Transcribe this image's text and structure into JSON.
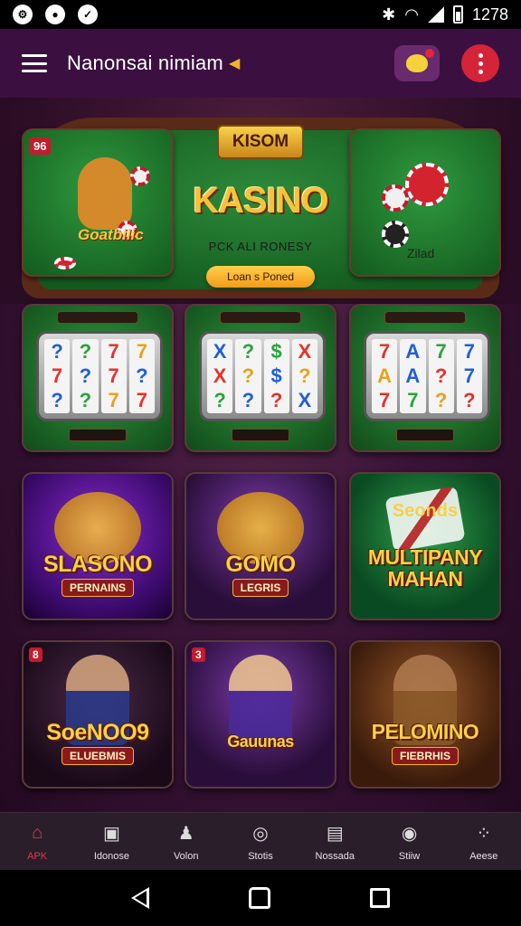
{
  "status_bar": {
    "time": "1278",
    "left_icons": [
      "settings-icon",
      "alert-icon",
      "messenger-icon"
    ],
    "right_icons": [
      "bluetooth-icon",
      "wifi-icon",
      "signal-icon",
      "battery-icon"
    ]
  },
  "header": {
    "title": "Nanonsai nimiam",
    "title_suffix_icon": "arrow-icon",
    "avatar_icon": "mascot-icon",
    "menu_icon": "more-vertical-icon"
  },
  "hero": {
    "left_card": {
      "badge": "96",
      "label": "Goatbilic"
    },
    "logo": "KISOM",
    "title": "KASINO",
    "subtitle": "PCK ALI RONESY",
    "cta": "Loan s Poned",
    "right_card": {
      "label": "Zilad"
    }
  },
  "slots": [
    {
      "reels": [
        [
          "?",
          "7",
          "?"
        ],
        [
          "?",
          "?",
          "?"
        ],
        [
          "7",
          "7",
          "7"
        ],
        [
          "7",
          "?",
          "7"
        ]
      ]
    },
    {
      "reels": [
        [
          "X",
          "X",
          "?"
        ],
        [
          "?",
          "?",
          "?"
        ],
        [
          "$",
          "$",
          "?"
        ],
        [
          "X",
          "?",
          "X"
        ]
      ]
    },
    {
      "reels": [
        [
          "7",
          "A",
          "7"
        ],
        [
          "A",
          "A",
          "7"
        ],
        [
          "7",
          "?",
          "?"
        ],
        [
          "7",
          "7",
          "?"
        ]
      ]
    }
  ],
  "games": [
    {
      "name": "SLASONO",
      "sub": "PERNAINS",
      "style": "purple",
      "emblem": "trophy"
    },
    {
      "name": "GOMO",
      "sub": "LEGRIS",
      "style": "purple2",
      "emblem": "mascot"
    },
    {
      "name": "MULTIPANY",
      "name2": "MAHAN",
      "top_text": "Seonds",
      "style": "green",
      "emblem": "cards"
    },
    {
      "name": "SoeNOO9",
      "sub": "ELUEBMIS",
      "badge": "8",
      "style": "dark",
      "emblem": "person"
    },
    {
      "name": "Gauunas",
      "badge": "3",
      "style": "purple2",
      "emblem": "person"
    },
    {
      "name": "PELOMINO",
      "sub": "FIEBRHIS",
      "style": "gold",
      "emblem": "person"
    }
  ],
  "bottom_nav": [
    {
      "label": "APK",
      "icon": "home-icon",
      "active": true
    },
    {
      "label": "Idonose",
      "icon": "file-icon",
      "active": false
    },
    {
      "label": "Volon",
      "icon": "person-icon",
      "active": false
    },
    {
      "label": "Stotis",
      "icon": "compass-icon",
      "active": false
    },
    {
      "label": "Nossada",
      "icon": "window-icon",
      "active": false
    },
    {
      "label": "Stiiw",
      "icon": "gamepad-icon",
      "active": false
    },
    {
      "label": "Aeese",
      "icon": "grid-icon",
      "active": false
    }
  ],
  "colors": {
    "app_bg": "#3a1438",
    "header_bg": "#3b1040",
    "accent_red": "#d52337",
    "gold": "#f6c23a",
    "felt_green": "#2d8a3a"
  }
}
